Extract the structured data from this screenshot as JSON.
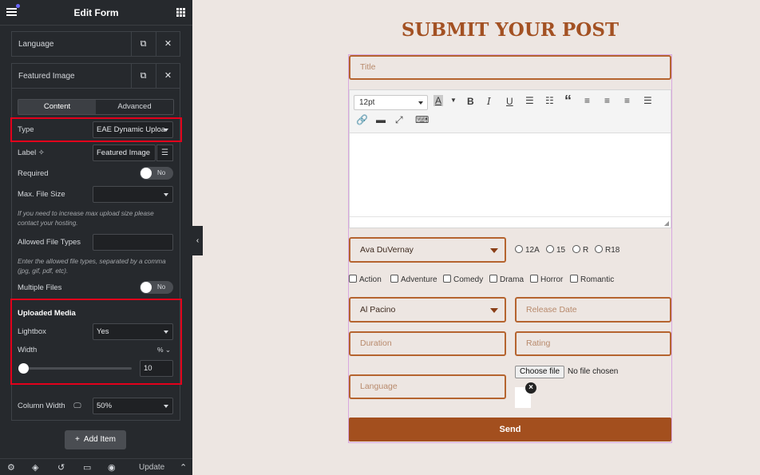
{
  "panel": {
    "title": "Edit Form",
    "repeater_items": [
      "Language",
      "Featured Image"
    ],
    "tabs": [
      "Content",
      "Advanced"
    ],
    "type": {
      "label": "Type",
      "value": "EAE Dynamic Uploa"
    },
    "label_field": {
      "label": "Label",
      "value": "Featured Image"
    },
    "required": {
      "label": "Required",
      "toggle": "No"
    },
    "max_file_size": {
      "label": "Max. File Size",
      "help": "If you need to increase max upload size please contact your hosting."
    },
    "allowed_types": {
      "label": "Allowed File Types",
      "help": "Enter the allowed file types, separated by a comma (jpg, gif, pdf, etc)."
    },
    "multiple_files": {
      "label": "Multiple Files",
      "toggle": "No"
    },
    "uploaded_media": {
      "heading": "Uploaded Media",
      "lightbox_label": "Lightbox",
      "lightbox_value": "Yes",
      "width_label": "Width",
      "width_unit": "% ⌄",
      "width_value": "10"
    },
    "column_width": {
      "label": "Column Width",
      "value": "50%"
    },
    "add_item": "Add Item",
    "footer_update": "Update"
  },
  "form": {
    "heading": "SUBMIT YOUR POST",
    "title_placeholder": "Title",
    "font_size": "12pt",
    "director": "Ava DuVernay",
    "ratings": [
      "12A",
      "15",
      "R",
      "R18"
    ],
    "genres": [
      "Action",
      "Adventure",
      "Comedy",
      "Drama",
      "Horror",
      "Romantic"
    ],
    "actor": "Al Pacino",
    "release_placeholder": "Release Date",
    "duration_placeholder": "Duration",
    "rating_placeholder": "Rating",
    "language_placeholder": "Language",
    "choose_file": "Choose file",
    "no_file": "No file chosen",
    "remove": "×",
    "send": "Send"
  }
}
